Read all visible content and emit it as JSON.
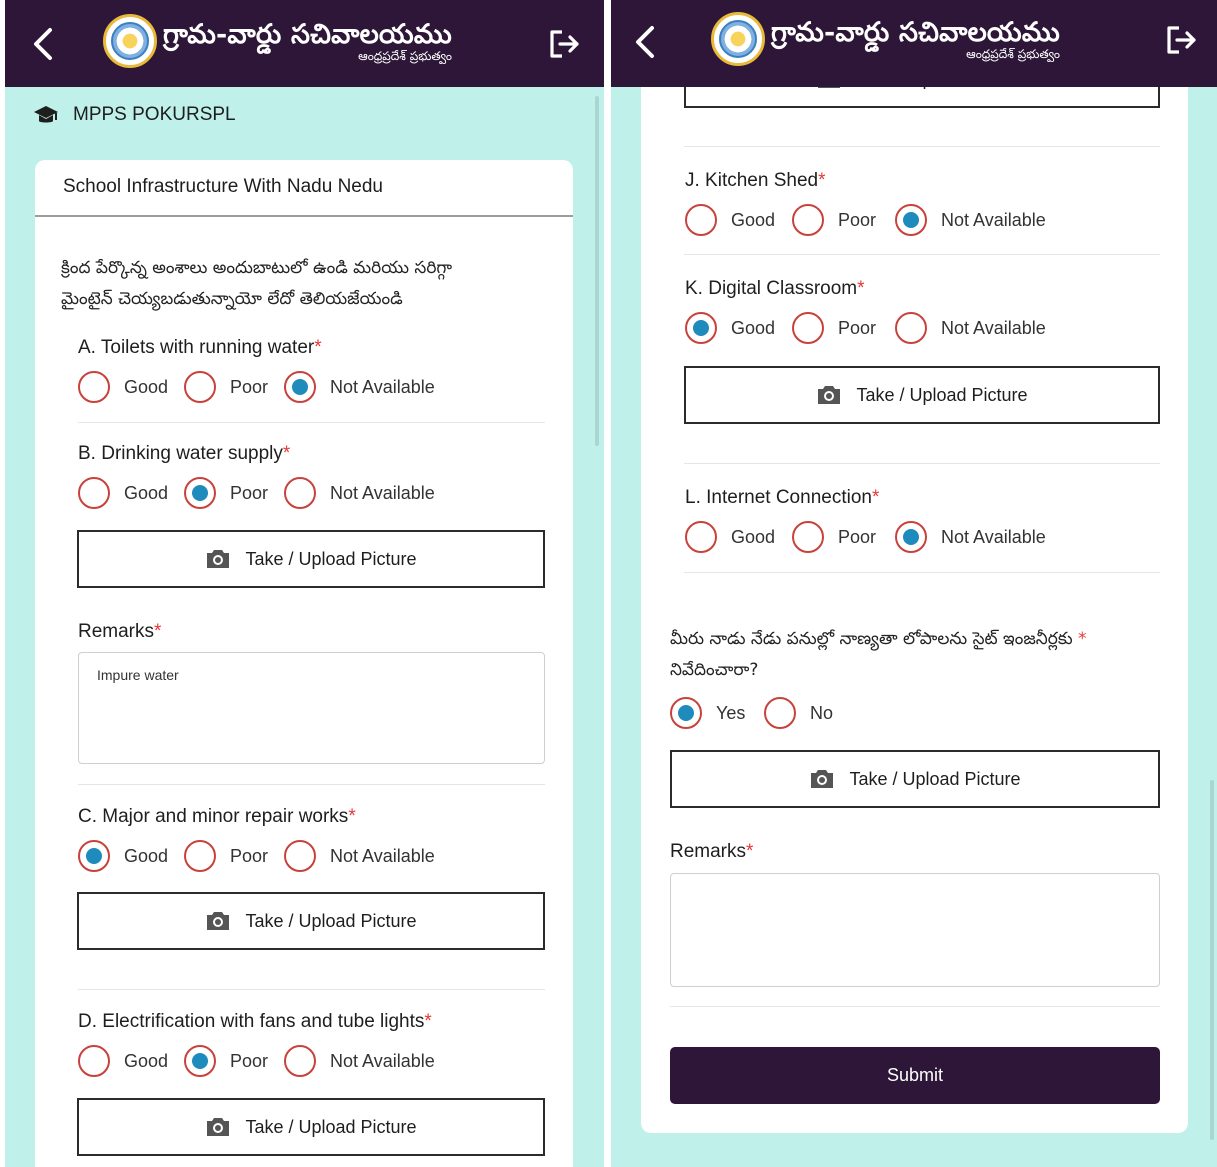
{
  "app": {
    "title": "గ్రామ-వార్డు సచివాలయము",
    "subtitle": "ఆంధ్రప్రదేశ్ ప్రభుత్వం",
    "icons": {
      "back": "chevron-left-icon",
      "logout": "logout-icon",
      "emblem": "ap-emblem-logo",
      "school": "graduation-cap-icon",
      "camera": "camera-icon"
    },
    "colors": {
      "appbar": "#2d1637",
      "background": "#bff0ea",
      "radio_border": "#c8413b",
      "radio_fill": "#1f8bbd",
      "required": "#e53935"
    }
  },
  "school": {
    "name": "MPPS POKURSPL"
  },
  "section": {
    "title": "School Infrastructure With Nadu Nedu",
    "intro_line1": "క్రింద పేర్కొన్న అంశాలు అందుబాటులో ఉండి మరియు సరిగ్గా",
    "intro_line2": "మైంటైన్ చెయ్యబడుతున్నాయో లేదో తెలియజేయండి"
  },
  "options": {
    "good": "Good",
    "poor": "Poor",
    "not_available": "Not Available",
    "yes": "Yes",
    "no": "No"
  },
  "required_mark": "*",
  "upload_label": "Take / Upload Picture",
  "questions": {
    "a": {
      "title": "A. Toilets with running water",
      "selected": "Not Available"
    },
    "b": {
      "title": "B. Drinking water supply",
      "selected": "Poor"
    },
    "c": {
      "title": "C. Major and minor repair works",
      "selected": "Good"
    },
    "d": {
      "title": "D. Electrification with fans and tube lights",
      "selected": "Poor"
    },
    "j": {
      "title": "J. Kitchen Shed",
      "selected": "Not Available"
    },
    "k": {
      "title": "K. Digital Classroom",
      "selected": "Good"
    },
    "l": {
      "title": "L. Internet Connection",
      "selected": "Not Available"
    }
  },
  "remarks": {
    "label": "Remarks",
    "left_value": "Impure water",
    "right_value": ""
  },
  "quality_question": {
    "line1": "మీరు నాడు నేడు పనుల్లో నాణ్యతా లోపాలను సైట్ ఇంజనీర్లకు",
    "line2": "నివేదించారా?",
    "selected": "Yes"
  },
  "submit_label": "Submit"
}
